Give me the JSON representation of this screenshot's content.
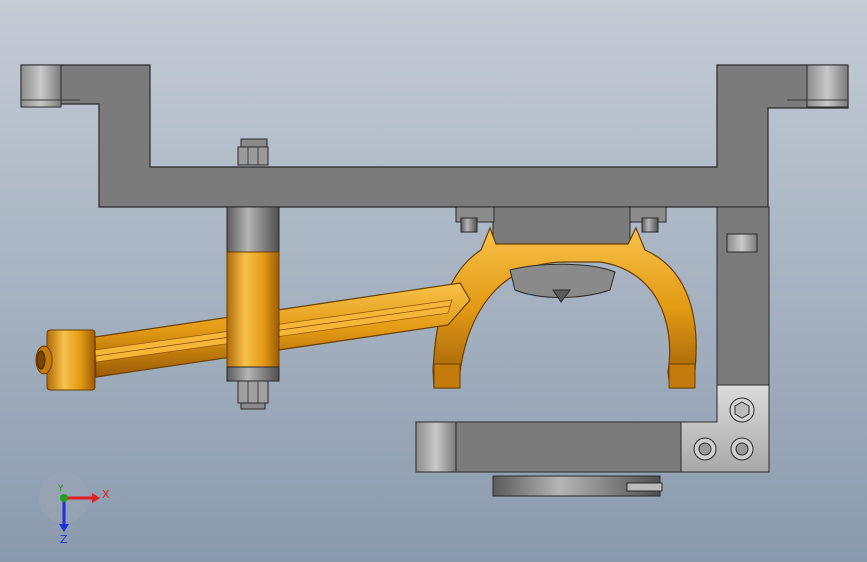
{
  "viewport": {
    "background_top": "#c4ccd6",
    "background_bottom": "#8a9aad"
  },
  "colors": {
    "steel": "#7b7b7b",
    "steel_dark": "#4a4a4a",
    "steel_light": "#b8b8b8",
    "orange": "#e39a14",
    "orange_light": "#f7c24a",
    "orange_dark": "#9b5c06",
    "plate": "#c9c9c9"
  },
  "triad": {
    "x_label": "X",
    "y_label": "Y",
    "z_label": "Z",
    "x_color": "#e02020",
    "y_color": "#20a020",
    "z_color": "#2030e0"
  }
}
